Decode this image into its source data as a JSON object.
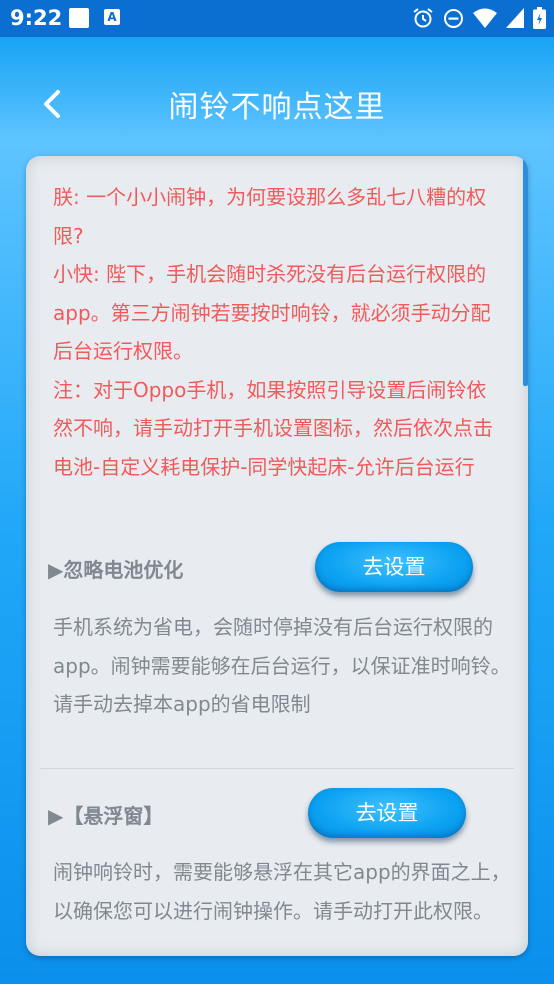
{
  "status_bar": {
    "time": "9:22",
    "notification_letter": "A",
    "icons": [
      "alarm-icon",
      "dnd-icon",
      "wifi-icon",
      "signal-icon",
      "battery-icon"
    ]
  },
  "header": {
    "title": "闹铃不响点这里",
    "back_icon": "chevron-left-icon"
  },
  "intro": {
    "lines": [
      "朕: 一个小小闹钟，为何要设那么多乱七八糟的权限?",
      "小快: 陛下，手机会随时杀死没有后台运行权限的app。第三方闹钟若要按时响铃，就必须手动分配后台运行权限。",
      "注：对于Oppo手机，如果按照引导设置后闹铃依然不响，请手动打开手机设置图标，然后依次点击 电池-自定义耗电保护-同学快起床-允许后台运行"
    ]
  },
  "sections": [
    {
      "title": "▶忽略电池优化",
      "button_label": "去设置",
      "description": "手机系统为省电，会随时停掉没有后台运行权限的app。闹钟需要能够在后台运行，以保证准时响铃。",
      "hint": "请手动去掉本app的省电限制"
    },
    {
      "title": "▶【悬浮窗】",
      "button_label": "去设置",
      "description": "闹钟响铃时，需要能够悬浮在其它app的界面之上，以确保您可以进行闹钟操作。请手动打开此权限。"
    }
  ],
  "colors": {
    "accent": "#0ca2f2",
    "warning_text": "#f05a5a",
    "muted_text": "#808890",
    "status_bar": "#0a6fd0"
  }
}
